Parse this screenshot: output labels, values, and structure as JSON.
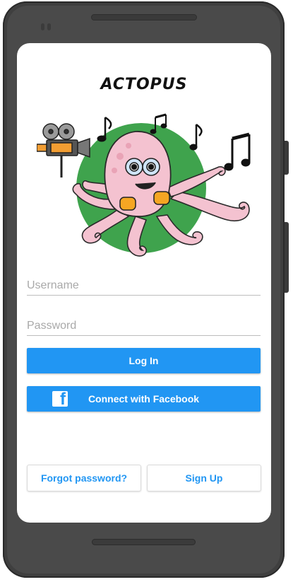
{
  "app": {
    "title": "ACTOPUS"
  },
  "login": {
    "username_placeholder": "Username",
    "password_placeholder": "Password",
    "login_label": "Log In",
    "facebook_label": "Connect with Facebook",
    "facebook_icon_letter": "f"
  },
  "footer": {
    "forgot_label": "Forgot password?",
    "signup_label": "Sign Up"
  },
  "colors": {
    "accent": "#2196f3",
    "mascot_circle": "#3fa34d",
    "mascot_body": "#f4c2d0"
  },
  "icons": [
    "facebook-icon",
    "film-camera-icon",
    "music-note-icon"
  ]
}
